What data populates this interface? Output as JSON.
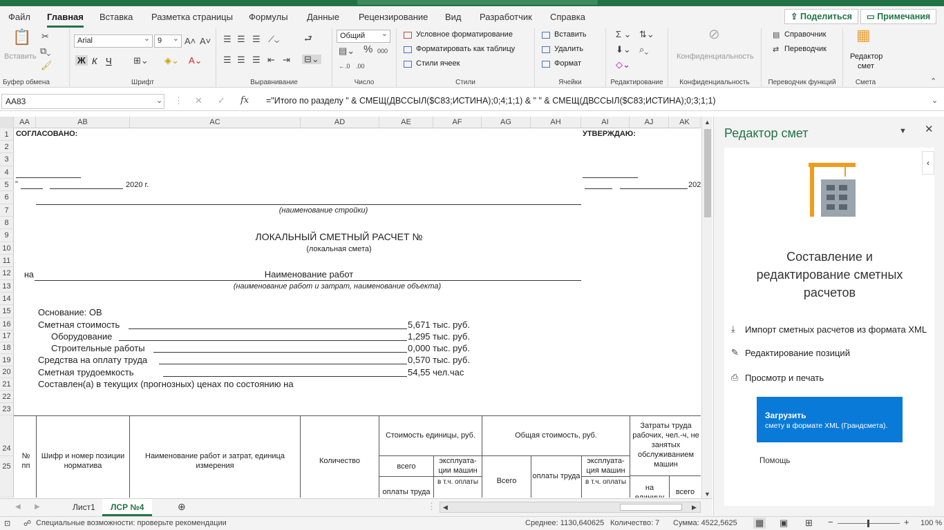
{
  "menu": {
    "tabs": [
      "Файл",
      "Главная",
      "Вставка",
      "Разметка страницы",
      "Формулы",
      "Данные",
      "Рецензирование",
      "Вид",
      "Разработчик",
      "Справка"
    ],
    "share": "Поделиться",
    "comments": "Примечания"
  },
  "ribbon": {
    "paste": "Вставить",
    "clipboard_group": "Буфер обмена",
    "font_name": "Arial",
    "font_size": "9",
    "font_group": "Шрифт",
    "bold": "Ж",
    "italic": "К",
    "underline": "Ч",
    "align_group": "Выравнивание",
    "number_format": "Общий",
    "number_group": "Число",
    "cond_format": "Условное форматирование",
    "format_table": "Форматировать как таблицу",
    "cell_styles": "Стили ячеек",
    "styles_group": "Стили",
    "insert": "Вставить",
    "delete": "Удалить",
    "format": "Формат",
    "cells_group": "Ячейки",
    "editing_group": "Редактирование",
    "privacy": "Конфиденциальность",
    "privacy_group": "Конфиденциальность",
    "reference": "Справочник",
    "translator": "Переводчик",
    "func_translator_group": "Переводчик функций",
    "estimate_editor_line1": "Редактор",
    "estimate_editor_line2": "смет",
    "estimate_group": "Смета"
  },
  "formula_bar": {
    "name_box": "AA83",
    "fx": "fx",
    "formula": "=\"Итого по разделу \" & СМЕЩ(ДВССЫЛ($C83;ИСТИНА);0;4;1;1) & \" \" & СМЕЩ(ДВССЫЛ($C83;ИСТИНА);0;3;1;1)"
  },
  "grid": {
    "columns": [
      "AA",
      "AB",
      "AC",
      "AD",
      "AE",
      "AF",
      "AG",
      "AH",
      "AI",
      "AJ",
      "AK"
    ],
    "rows": [
      "1",
      "2",
      "3",
      "4",
      "5",
      "6",
      "7",
      "8",
      "9",
      "10",
      "11",
      "12",
      "13",
      "14",
      "15",
      "16",
      "17",
      "18",
      "19",
      "20",
      "21",
      "22",
      "23",
      "24",
      "25"
    ],
    "agreed": "СОГЛАСОВАНО:",
    "approve": "УТВЕРЖДАЮ:",
    "date_left_quote": "\"",
    "date_left": "2020 г.",
    "date_right": "202",
    "construction_caption": "(наименование стройки)",
    "doc_title": "ЛОКАЛЬНЫЙ СМЕТНЫЙ РАСЧЕТ №",
    "doc_subtitle": "(локальная смета)",
    "na": "на",
    "works_name": "Наименование работ",
    "works_caption": "(наименование работ и затрат, наименование объекта)",
    "basis": "Основание: ОВ",
    "cost_label": "Сметная стоимость",
    "cost_value": "5,671 тыс. руб.",
    "equipment_label": "Оборудование",
    "equipment_value": "1,295 тыс. руб.",
    "construction_label": "Строительные работы",
    "construction_value": "0,000 тыс. руб.",
    "wages_label": "Средства на оплату труда",
    "wages_value": "0,570 тыс. руб.",
    "labor_label": "Сметная трудоемкость",
    "labor_value": "54,55 чел.час",
    "prices_note": "Составлен(а) в текущих (прогнозных) ценах по состоянию на",
    "table": {
      "num": "№ пп",
      "code": "Шифр и номер позиции норматива",
      "name": "Наименование работ и затрат, единица измерения",
      "qty": "Количество",
      "unit_cost": "Стоимость единицы, руб.",
      "total_cost": "Общая стоимость, руб.",
      "labor": "Затраты труда рабочих, чел.-ч, не занятых обслуживанием машин",
      "all": "всего",
      "machine_op": "эксплуата-ции машин",
      "wages_pay": "оплаты труда",
      "incl": "в т.ч. оплаты",
      "total": "Всего",
      "wages_pay2": "оплаты труда",
      "machine_op2": "эксплуата-ция машин",
      "incl2": "в т.ч. оплаты",
      "per_unit": "на единицу",
      "all2": "всего"
    }
  },
  "sheets": {
    "tabs": [
      "Лист1",
      "ЛСР №4"
    ],
    "active": "ЛСР №4"
  },
  "pane": {
    "title": "Редактор смет",
    "heading": "Составление и редактирование сметных расчетов",
    "links": [
      "Импорт сметных расчетов из формата XML",
      "Редактирование позиций",
      "Просмотр и печать"
    ],
    "load_btn_title": "Загрузить",
    "load_btn_sub": "смету в формате XML (Грандсмета).",
    "help": "Помощь"
  },
  "status": {
    "accessibility": "Специальные возможности: проверьте рекомендации",
    "average": "Среднее: 1130,640625",
    "count": "Количество: 7",
    "sum": "Сумма: 4522,5625",
    "zoom": "100 %"
  },
  "colors": {
    "accent": "#217346",
    "button": "#0a7ad8"
  }
}
